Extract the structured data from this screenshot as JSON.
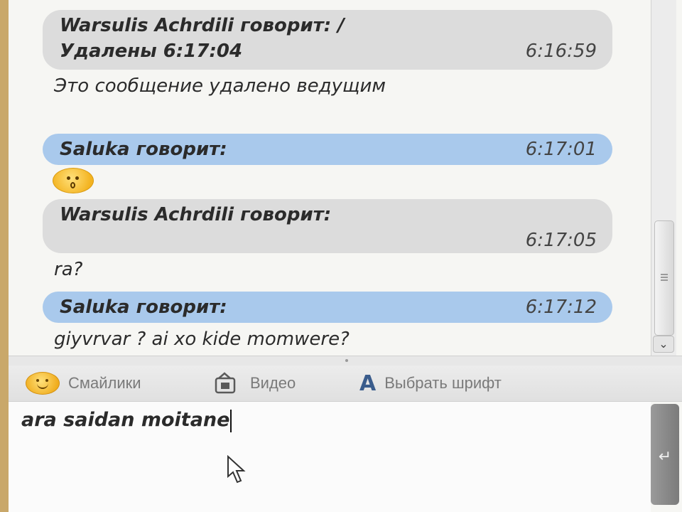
{
  "messages": [
    {
      "sender_line": "Warsulis Achrdili говорит:  /",
      "sub_line": "Удалены 6:17:04",
      "time": "6:16:59",
      "style": "gray"
    },
    {
      "text": " Это сообщение удалено ведущим"
    },
    {
      "sender_line": "Saluka говорит:",
      "time": "6:17:01",
      "style": "blue"
    },
    {
      "emoticon": "surprised-smiley-icon"
    },
    {
      "sender_line": "Warsulis Achrdili говорит:",
      "time": "6:17:05",
      "style": "gray"
    },
    {
      "text": "ra?"
    },
    {
      "sender_line": "Saluka говорит:",
      "time": "6:17:12",
      "style": "blue"
    },
    {
      "text": "giyvrvar ? ai xo kide momwere?"
    }
  ],
  "toolbar": {
    "smileys_label": "Смайлики",
    "video_label": "Видео",
    "font_label": "Выбрать шрифт",
    "font_icon_glyph": "A"
  },
  "input": {
    "value": "ara saidan moitane"
  },
  "send": {
    "icon": "enter-icon",
    "glyph": "↵"
  },
  "scrollbar": {
    "down_glyph": "⌄"
  },
  "colors": {
    "bubble_gray": "#dcdcdc",
    "bubble_blue": "#a9c9ec",
    "font_icon": "#3a5c8c"
  }
}
